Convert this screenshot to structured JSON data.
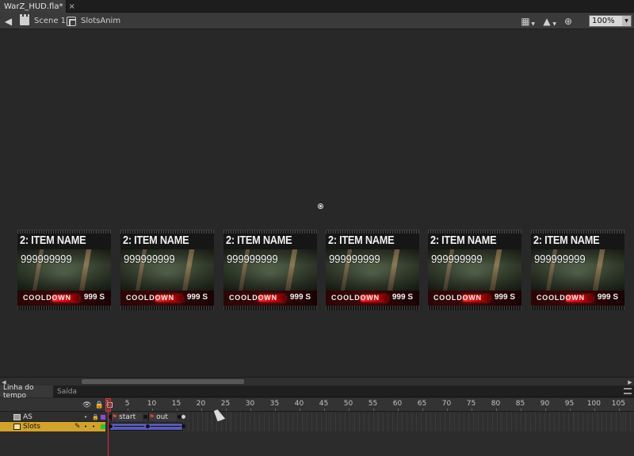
{
  "document_tab": {
    "title": "WarZ_HUD.fla*",
    "close_glyph": "×"
  },
  "editbar": {
    "scene": "Scene 1",
    "symbol": "SlotsAnim",
    "zoom": "100%"
  },
  "slots": [
    {
      "title": "2: ITEM NAME",
      "value": "999999999",
      "cooldown_label": "COOLDOWN",
      "cooldown_time": "999 S"
    },
    {
      "title": "2: ITEM NAME",
      "value": "999999999",
      "cooldown_label": "COOLDOWN",
      "cooldown_time": "999 S"
    },
    {
      "title": "2: ITEM NAME",
      "value": "999999999",
      "cooldown_label": "COOLDOWN",
      "cooldown_time": "999 S"
    },
    {
      "title": "2: ITEM NAME",
      "value": "999999999",
      "cooldown_label": "COOLDOWN",
      "cooldown_time": "999 S"
    },
    {
      "title": "2: ITEM NAME",
      "value": "999999999",
      "cooldown_label": "COOLDOWN",
      "cooldown_time": "999 S"
    },
    {
      "title": "2: ITEM NAME",
      "value": "999999999",
      "cooldown_label": "COOLDOWN",
      "cooldown_time": "999 S"
    }
  ],
  "panel_tabs": {
    "timeline": "Linha do tempo",
    "output": "Saída"
  },
  "timeline": {
    "ruler": [
      "1",
      "5",
      "10",
      "15",
      "20",
      "25",
      "30",
      "35",
      "40",
      "45",
      "50",
      "55",
      "60",
      "65",
      "70",
      "75",
      "80",
      "85",
      "90",
      "95",
      "100",
      "105"
    ],
    "layers": [
      {
        "name": "AS",
        "frame_labels": [
          "start",
          "out"
        ]
      },
      {
        "name": "Slots"
      }
    ]
  },
  "icons": {
    "back": "back-arrow-icon",
    "scene": "clapper-icon",
    "symbol": "movieclip-symbol-icon",
    "edit_scene": "edit-scene-icon",
    "edit_symbols": "edit-symbols-icon",
    "center_stage": "center-stage-icon"
  },
  "colors": {
    "accent_layer": "#d1a32a",
    "playhead": "#e03030",
    "tween": "#5a5ab8",
    "cooldown_bar": "#ff2a2a"
  }
}
